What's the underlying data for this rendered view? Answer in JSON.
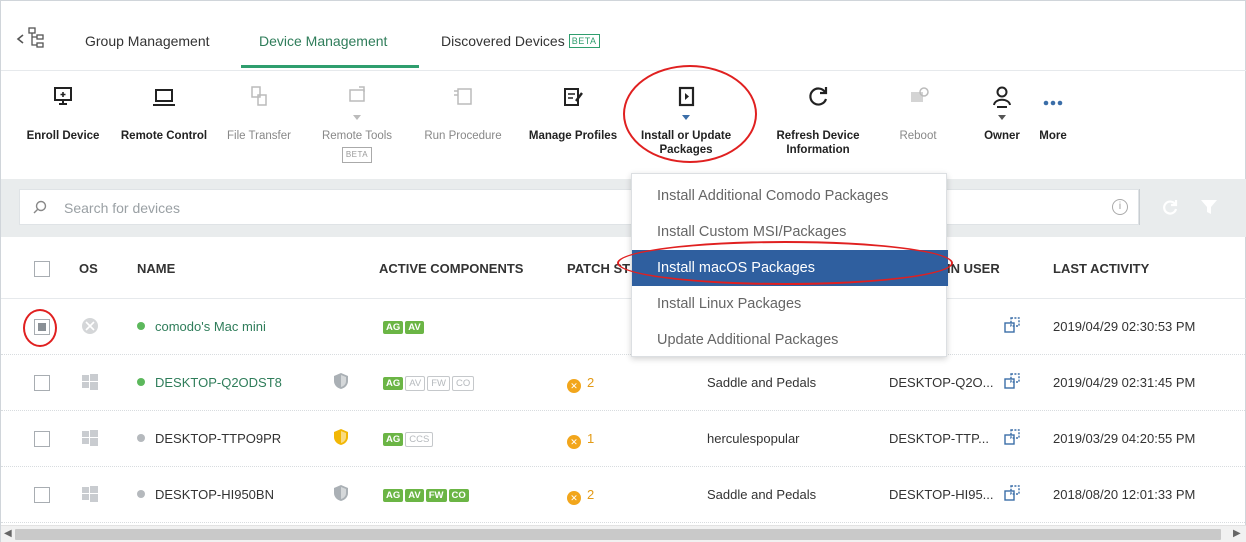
{
  "tabs": [
    {
      "label": "Group Management"
    },
    {
      "label": "Device Management"
    },
    {
      "label": "Discovered Devices",
      "badge": "BETA"
    }
  ],
  "toolbar": [
    {
      "label": "Enroll Device",
      "icon": "enroll-device-icon"
    },
    {
      "label": "Remote Control",
      "icon": "laptop-icon"
    },
    {
      "label": "File Transfer",
      "icon": "file-transfer-icon"
    },
    {
      "label": "Remote Tools",
      "icon": "remote-tools-icon",
      "badge": "BETA"
    },
    {
      "label": "Run Procedure",
      "icon": "run-procedure-icon"
    },
    {
      "label": "Manage Profiles",
      "icon": "manage-profiles-icon"
    },
    {
      "label1": "Install or Update",
      "label2": "Packages",
      "icon": "package-icon"
    },
    {
      "label1": "Refresh Device",
      "label2": "Information",
      "icon": "refresh-icon"
    },
    {
      "label": "Reboot",
      "icon": "reboot-icon"
    },
    {
      "label": "Owner",
      "icon": "owner-icon"
    },
    {
      "label": "More",
      "icon": "more-icon"
    }
  ],
  "search": {
    "placeholder": "Search for devices"
  },
  "columns": {
    "os": "OS",
    "name": "NAME",
    "active_components": "ACTIVE COMPONENTS",
    "patch_status": "PATCH ST",
    "logged_in_user": "IN USER",
    "last_activity": "LAST ACTIVITY"
  },
  "dropdown": {
    "items": [
      "Install Additional Comodo Packages",
      "Install Custom MSI/Packages",
      "Install macOS Packages",
      "Install Linux Packages",
      "Update Additional Packages"
    ],
    "selected_index": 2
  },
  "rows": [
    {
      "name": "comodo's Mac mini",
      "os": "mac",
      "status": "online",
      "components": [
        {
          "t": "AG",
          "on": true
        },
        {
          "t": "AV",
          "on": true
        }
      ],
      "patches": "",
      "owner": "",
      "logged_user": "",
      "last_activity": "2019/04/29 02:30:53 PM"
    },
    {
      "name": "DESKTOP-Q2ODST8",
      "os": "windows",
      "status": "online",
      "components": [
        {
          "t": "AG",
          "on": true
        },
        {
          "t": "AV",
          "on": false
        },
        {
          "t": "FW",
          "on": false
        },
        {
          "t": "CO",
          "on": false
        }
      ],
      "patches": "2",
      "owner": "Saddle and Pedals",
      "logged_user": "DESKTOP-Q2O...",
      "last_activity": "2019/04/29 02:31:45 PM"
    },
    {
      "name": "DESKTOP-TTPO9PR",
      "os": "windows",
      "status": "offline",
      "components": [
        {
          "t": "AG",
          "on": true
        },
        {
          "t": "CCS",
          "on": false
        }
      ],
      "patches": "1",
      "owner": "herculespopular",
      "logged_user": "DESKTOP-TTP...",
      "last_activity": "2019/03/29 04:20:55 PM"
    },
    {
      "name": "DESKTOP-HI950BN",
      "os": "windows",
      "status": "offline",
      "components": [
        {
          "t": "AG",
          "on": true
        },
        {
          "t": "AV",
          "on": true
        },
        {
          "t": "FW",
          "on": true
        },
        {
          "t": "CO",
          "on": true
        }
      ],
      "patches": "2",
      "owner": "Saddle and Pedals",
      "logged_user": "DESKTOP-HI95...",
      "last_activity": "2018/08/20 12:01:33 PM"
    }
  ],
  "colors": {
    "accent": "#2f9e6e",
    "selected": "#2f5f9f",
    "annotation": "#e02020"
  }
}
